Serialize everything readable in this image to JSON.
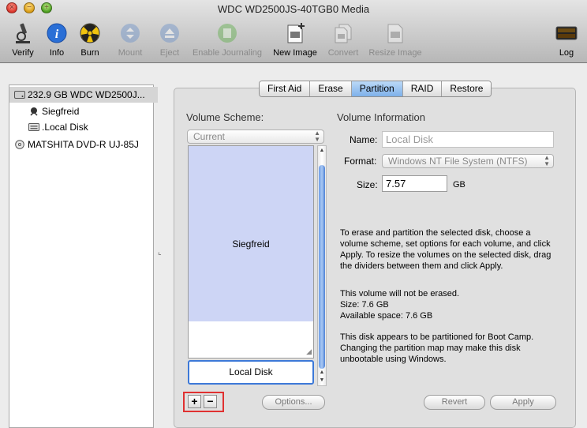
{
  "window": {
    "title": "WDC WD2500JS-40TGB0 Media"
  },
  "toolbar": {
    "items": [
      {
        "label": "Verify",
        "icon": "microscope-icon"
      },
      {
        "label": "Info",
        "icon": "info-icon"
      },
      {
        "label": "Burn",
        "icon": "burn-icon"
      },
      {
        "label": "Mount",
        "icon": "mount-icon"
      },
      {
        "label": "Eject",
        "icon": "eject-icon"
      },
      {
        "label": "Enable Journaling",
        "icon": "journal-icon"
      },
      {
        "label": "New Image",
        "icon": "new-image-icon"
      },
      {
        "label": "Convert",
        "icon": "convert-icon"
      },
      {
        "label": "Resize Image",
        "icon": "resize-image-icon"
      },
      {
        "label": "Log",
        "icon": "log-icon"
      }
    ]
  },
  "sidebar": {
    "items": [
      {
        "label": "232.9 GB WDC WD2500J...",
        "icon": "hard-drive-icon",
        "selected": true
      },
      {
        "label": "Siegfreid",
        "icon": "volume-icon"
      },
      {
        "label": ".Local Disk",
        "icon": "volume-icon"
      },
      {
        "label": "MATSHITA DVD-R UJ-85J",
        "icon": "optical-drive-icon"
      }
    ]
  },
  "tabs": [
    {
      "label": "First Aid"
    },
    {
      "label": "Erase"
    },
    {
      "label": "Partition",
      "active": true
    },
    {
      "label": "RAID"
    },
    {
      "label": "Restore"
    }
  ],
  "scheme": {
    "title": "Volume Scheme:",
    "select_value": "Current",
    "partitions": [
      {
        "label": "Siegfreid"
      },
      {
        "label": "Local Disk"
      }
    ]
  },
  "info": {
    "title": "Volume Information",
    "name_label": "Name:",
    "name_value": "Local Disk",
    "format_label": "Format:",
    "format_value": "Windows NT File System (NTFS)",
    "size_label": "Size:",
    "size_value": "7.57",
    "size_unit": "GB",
    "instructions": "To erase and partition the selected disk, choose a volume scheme, set options for each volume, and click Apply. To resize the volumes on the selected disk, drag the dividers between them and click Apply.",
    "status_line1": "This volume will not be erased.",
    "status_line2": "Size: 7.6 GB",
    "status_line3": "Available space: 7.6 GB",
    "bootcamp": "This disk appears to be partitioned for Boot Camp. Changing the partition map may make this disk unbootable using Windows."
  },
  "buttons": {
    "add": "+",
    "remove": "−",
    "options": "Options...",
    "revert": "Revert",
    "apply": "Apply"
  },
  "colors": {
    "accent": "#3d79d8",
    "partition_fill": "#cdd5f5",
    "highlight_box": "#e03131"
  }
}
